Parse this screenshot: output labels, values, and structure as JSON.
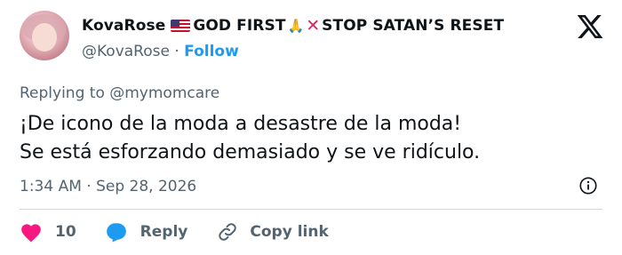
{
  "author": {
    "display_name": "KovaRose",
    "name_suffix_1": "GOD FIRST",
    "name_suffix_2": "STOP SATAN’S RESET",
    "handle": "@KovaRose",
    "separator": "·",
    "follow_label": "Follow"
  },
  "tweet": {
    "replying_to_prefix": "Replying to",
    "replying_to_handle": "@mymomcare",
    "text_line_1": "¡De icono de la moda a desastre de la moda!",
    "text_line_2": "Se está esforzando demasiado y se ve ridículo.",
    "timestamp": "1:34 AM · Sep 28, 2026"
  },
  "actions": {
    "like_count": "10",
    "reply_label": "Reply",
    "copy_link_label": "Copy link"
  },
  "icons": [
    "x-logo-icon",
    "us-flag-icon",
    "praying-hands-icon",
    "cross-mark-icon",
    "info-icon",
    "heart-icon",
    "reply-bubble-icon",
    "link-icon"
  ],
  "colors": {
    "text": "#0f1419",
    "secondary": "#536471",
    "link": "#1d9bf0",
    "heart": "#f91880",
    "divider": "#cfd9de",
    "cross": "#e0245e"
  }
}
